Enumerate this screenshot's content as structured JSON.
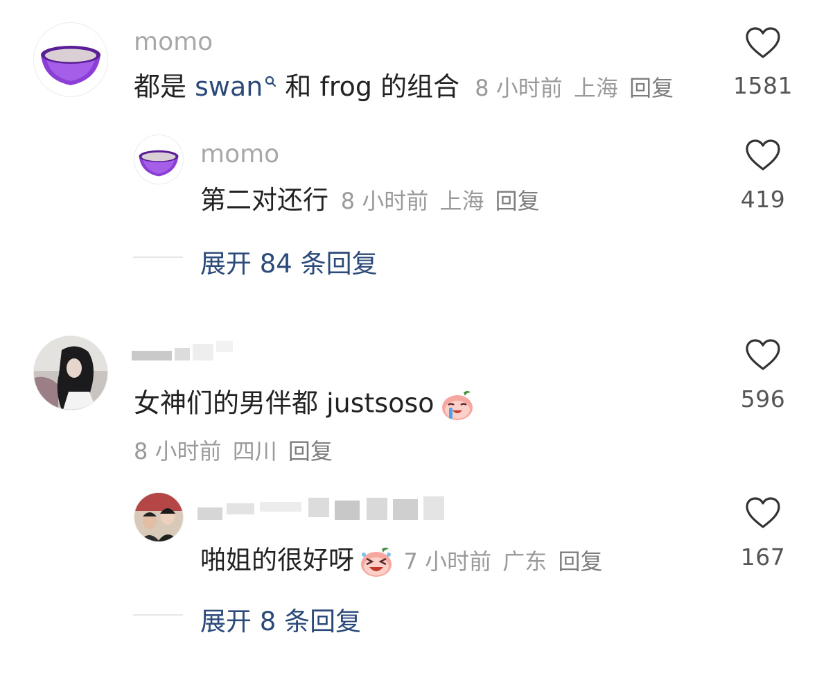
{
  "comments": [
    {
      "username": "momo",
      "text_prefix": "都是 ",
      "mention": "swan",
      "text_suffix": " 和 frog 的组合",
      "time": "8 小时前",
      "location": "上海",
      "reply": "回复",
      "likes": "1581",
      "avatar_icon": "purple-bowl-icon",
      "replies": [
        {
          "username": "momo",
          "text": "第二对还行",
          "time": "8 小时前",
          "location": "上海",
          "reply": "回复",
          "likes": "419",
          "avatar_icon": "purple-bowl-icon"
        }
      ],
      "expand_label": "展开 84 条回复"
    },
    {
      "username": "",
      "text": "女神们的男伴都 justsoso",
      "emoji": "crying-peach-emoji",
      "time": "8 小时前",
      "location": "四川",
      "reply": "回复",
      "likes": "596",
      "replies": [
        {
          "username": "",
          "text": "啪姐的很好呀",
          "emoji": "laughing-peach-emoji",
          "time": "7 小时前",
          "location": "广东",
          "reply": "回复",
          "likes": "167"
        }
      ],
      "expand_label": "展开 8 条回复"
    }
  ],
  "colors": {
    "link": "#2b4a7a",
    "meta": "#9a9a9a",
    "username": "#a8a8a8",
    "avatar_purple": "#8b3fd6"
  }
}
